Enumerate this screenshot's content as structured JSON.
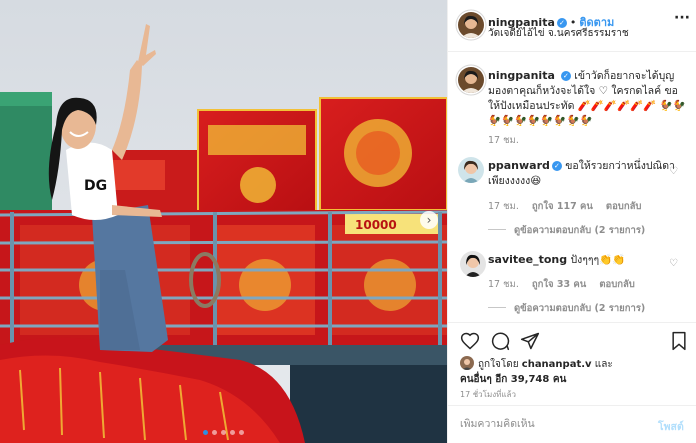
{
  "post": {
    "author": "ningpanita",
    "follow_separator": "•",
    "follow_label": "ติดตาม",
    "location": "วัดเจดีย์ไอ้ไข่ จ.นครศรีธรรมราช",
    "more_label": "···",
    "verified_mark": "✓"
  },
  "caption": {
    "username": "ningpanita",
    "text": "เข้าวัดก็อยากจะได้บุญ มองตาคุณก็หวังจะได้ใจ ♡ ใครกดไลค์ ขอให้ปังเหมือนประทัด 🧨🧨🧨🧨🧨🧨 🐓🐓🐓🐓🐓🐓🐓🐓🐓🐓",
    "time": "17 ชม."
  },
  "comments": [
    {
      "username": "ppanward",
      "text": "ขอให้รวยกว่าหนึ่งปณิดาเพียงงงงง😆",
      "time": "17 ชม.",
      "likes": "ถูกใจ 117 คน",
      "reply_label": "ตอบกลับ",
      "view_replies": "ดูข้อความตอบกลับ (2 รายการ)"
    },
    {
      "username": "savitee_tong",
      "text": "ปังๆๆๆ👏👏",
      "time": "17 ชม.",
      "likes": "ถูกใจ 33 คน",
      "reply_label": "ตอบกลับ",
      "view_replies": "ดูข้อความตอบกลับ (2 รายการ)"
    }
  ],
  "likes": {
    "prefix": "ถูกใจโดย",
    "user": "chananpat.v",
    "and": "และ",
    "others": "คนอื่นๆ อีก 39,748 คน"
  },
  "timestamp": "17 ชั่วโมงที่แล้ว",
  "comment_box": {
    "placeholder": "เพิ่มความคิดเห็น",
    "post_label": "โพสต์"
  },
  "carousel": {
    "next_glyph": "›",
    "dot_count": 5,
    "active_dot": 0
  },
  "photo": {
    "banner_text": "10000"
  },
  "colors": {
    "accent_blue": "#3897f0",
    "verified_blue": "#3897f0",
    "post_disabled": "#b2dffc",
    "muted_text": "#8e8e8e"
  }
}
